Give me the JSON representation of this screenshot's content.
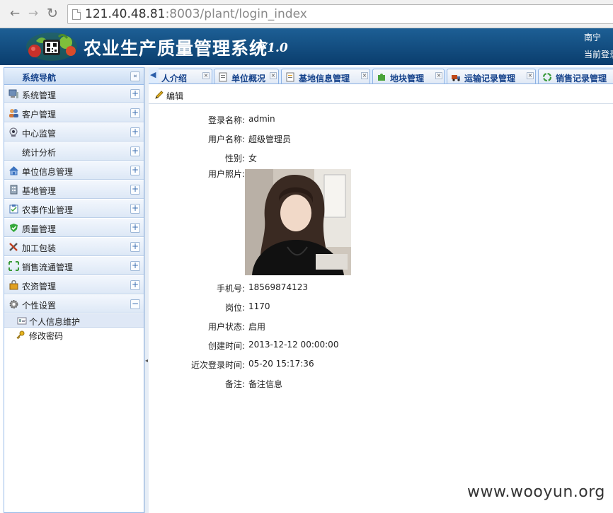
{
  "browser": {
    "address": {
      "host": "121.40.48.81",
      "rest": ":8003/plant/login_index"
    }
  },
  "header": {
    "title": "农业生产质量管理系统",
    "version": "V1.0",
    "right_line1": "南宁",
    "right_line2": "当前登录"
  },
  "sidebar": {
    "title": "系统导航",
    "items": [
      {
        "label": "系统管理",
        "icon": "computer-icon",
        "toggle": "+"
      },
      {
        "label": "客户管理",
        "icon": "users-icon",
        "toggle": "+"
      },
      {
        "label": "中心监管",
        "icon": "webcam-icon",
        "toggle": "+"
      },
      {
        "label": "统计分析",
        "icon": "",
        "toggle": "+"
      },
      {
        "label": "单位信息管理",
        "icon": "home-icon",
        "toggle": "+"
      },
      {
        "label": "基地管理",
        "icon": "building-icon",
        "toggle": "+"
      },
      {
        "label": "农事作业管理",
        "icon": "clipboard-icon",
        "toggle": "+"
      },
      {
        "label": "质量管理",
        "icon": "shield-check-icon",
        "toggle": "+"
      },
      {
        "label": "加工包装",
        "icon": "tools-icon",
        "toggle": "+"
      },
      {
        "label": "销售流通管理",
        "icon": "arrows-expand-icon",
        "toggle": "+"
      },
      {
        "label": "农资管理",
        "icon": "lock-box-icon",
        "toggle": "+"
      },
      {
        "label": "个性设置",
        "icon": "gear-icon",
        "toggle": "−"
      }
    ],
    "subitems": [
      {
        "label": "个人信息维护",
        "icon": "id-card-icon"
      },
      {
        "label": "修改密码",
        "icon": "key-icon"
      }
    ]
  },
  "tabs": [
    {
      "label": "人介绍",
      "icon": ""
    },
    {
      "label": "单位概况",
      "icon": "document-icon"
    },
    {
      "label": "基地信息管理",
      "icon": "document-icon"
    },
    {
      "label": "地块管理",
      "icon": "puzzle-icon"
    },
    {
      "label": "运输记录管理",
      "icon": "truck-icon"
    },
    {
      "label": "销售记录管理",
      "icon": "recycle-icon"
    }
  ],
  "toolbar": {
    "edit_label": "编辑"
  },
  "profile": {
    "fields": [
      {
        "label": "登录名称:",
        "value": "admin"
      },
      {
        "label": "用户名称:",
        "value": "超级管理员"
      },
      {
        "label": "性别:",
        "value": "女"
      },
      {
        "label": "用户照片:",
        "value": ""
      },
      {
        "label": "手机号:",
        "value": "18569874123"
      },
      {
        "label": "岗位:",
        "value": "1170"
      },
      {
        "label": "用户状态:",
        "value": "启用"
      },
      {
        "label": "创建时间:",
        "value": "2013-12-12 00:00:00"
      },
      {
        "label": "近次登录时间:",
        "value": "05-20 15:17:36"
      },
      {
        "label": "备注:",
        "value": "备注信息"
      }
    ]
  },
  "watermark": "www.wooyun.org",
  "colors": {
    "banner": "#0f4677",
    "nav_text": "#15428b",
    "panel_border": "#99bbe8"
  }
}
